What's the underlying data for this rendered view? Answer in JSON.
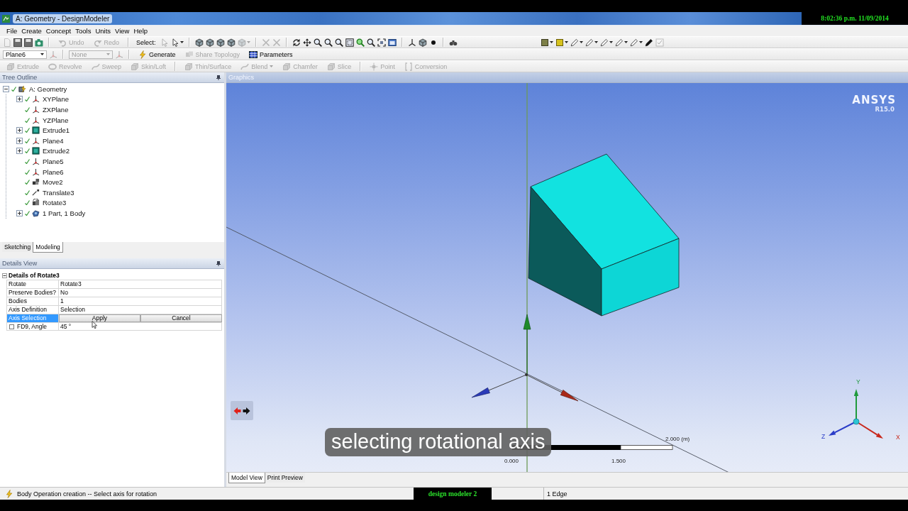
{
  "window": {
    "title": "A: Geometry - DesignModeler",
    "clock": "8:02:36 p.m. 11/09/2014"
  },
  "menu": [
    "File",
    "Create",
    "Concept",
    "Tools",
    "Units",
    "View",
    "Help"
  ],
  "toolbars": [
    [
      [
        {
          "kind": "icon",
          "disabled": true
        },
        {
          "kind": "icon",
          "disabled": false
        },
        {
          "kind": "icon",
          "disabled": false
        },
        {
          "kind": "icon",
          "disabled": false
        },
        {
          "kind": "separator"
        },
        {
          "kind": "button",
          "label": "Undo",
          "disabled": true
        },
        {
          "kind": "button",
          "label": "Redo",
          "disabled": true
        },
        {
          "kind": "separator"
        },
        {
          "kind": "label",
          "label": "Select:",
          "disabled": false
        },
        {
          "kind": "icon",
          "disabled": true
        },
        {
          "kind": "menu_icon",
          "disabled": false
        },
        {
          "kind": "separator"
        },
        {
          "kind": "icon",
          "disabled": false
        },
        {
          "kind": "icon",
          "disabled": false
        },
        {
          "kind": "icon",
          "disabled": false
        },
        {
          "kind": "icon",
          "disabled": false
        },
        {
          "kind": "menu_icon",
          "disabled": true
        },
        {
          "kind": "separator"
        },
        {
          "kind": "icon",
          "disabled": true
        },
        {
          "kind": "icon",
          "disabled": true
        },
        {
          "kind": "separator"
        },
        {
          "kind": "icon",
          "disabled": false
        },
        {
          "kind": "icon",
          "disabled": false
        },
        {
          "kind": "icon",
          "disabled": false
        },
        {
          "kind": "icon",
          "disabled": false
        },
        {
          "kind": "icon",
          "disabled": false
        },
        {
          "kind": "icon",
          "disabled": false
        },
        {
          "kind": "icon",
          "disabled": false
        },
        {
          "kind": "icon",
          "disabled": false
        },
        {
          "kind": "icon",
          "disabled": false
        },
        {
          "kind": "icon",
          "disabled": false
        },
        {
          "kind": "separator"
        },
        {
          "kind": "icon",
          "disabled": false
        },
        {
          "kind": "icon",
          "disabled": false
        },
        {
          "kind": "icon",
          "disabled": false
        },
        {
          "kind": "separator"
        },
        {
          "kind": "icon",
          "disabled": false
        }
      ],
      [
        {
          "kind": "menu_icon",
          "disabled": false
        },
        {
          "kind": "menu_icon",
          "disabled": false
        },
        {
          "kind": "menu_icon",
          "disabled": false
        },
        {
          "kind": "menu_icon",
          "disabled": false
        },
        {
          "kind": "menu_icon",
          "disabled": false
        },
        {
          "kind": "menu_icon",
          "disabled": false
        },
        {
          "kind": "menu_icon",
          "disabled": false
        },
        {
          "kind": "icon",
          "disabled": false
        },
        {
          "kind": "icon",
          "disabled": true
        }
      ]
    ],
    [
      [
        {
          "kind": "dropdown",
          "label": "Plane6",
          "disabled": false
        },
        {
          "kind": "icon",
          "disabled": true
        },
        {
          "kind": "separator"
        },
        {
          "kind": "dropdown",
          "label": "None",
          "disabled": true
        },
        {
          "kind": "icon",
          "disabled": true
        },
        {
          "kind": "separator"
        },
        {
          "kind": "button",
          "label": "Generate",
          "disabled": false
        },
        {
          "kind": "button",
          "label": "Share Topology",
          "disabled": true
        },
        {
          "kind": "button",
          "label": "Parameters",
          "disabled": false
        }
      ]
    ],
    [
      [
        {
          "kind": "button",
          "label": "Extrude",
          "disabled": true
        },
        {
          "kind": "button",
          "label": "Revolve",
          "disabled": true
        },
        {
          "kind": "button",
          "label": "Sweep",
          "disabled": true
        },
        {
          "kind": "button",
          "label": "Skin/Loft",
          "disabled": true
        },
        {
          "kind": "separator"
        },
        {
          "kind": "button",
          "label": "Thin/Surface",
          "disabled": true
        },
        {
          "kind": "menu_button",
          "label": "Blend",
          "disabled": true
        },
        {
          "kind": "button",
          "label": "Chamfer",
          "disabled": true
        },
        {
          "kind": "button",
          "label": "Slice",
          "disabled": true
        },
        {
          "kind": "separator"
        },
        {
          "kind": "button",
          "label": "Point",
          "disabled": true
        },
        {
          "kind": "button",
          "label": "Conversion",
          "disabled": true
        }
      ]
    ]
  ],
  "tree_outline": {
    "title": "Tree Outline",
    "items": [
      {
        "label": "A: Geometry",
        "kind": "geometry",
        "expanded": true,
        "children": [
          {
            "label": "XYPlane",
            "kind": "plane",
            "expanded": false
          },
          {
            "label": "ZXPlane",
            "kind": "plane"
          },
          {
            "label": "YZPlane",
            "kind": "plane"
          },
          {
            "label": "Extrude1",
            "kind": "extrude",
            "expanded": false
          },
          {
            "label": "Plane4",
            "kind": "plane",
            "expanded": false
          },
          {
            "label": "Extrude2",
            "kind": "extrude",
            "expanded": false
          },
          {
            "label": "Plane5",
            "kind": "plane"
          },
          {
            "label": "Plane6",
            "kind": "plane"
          },
          {
            "label": "Move2",
            "kind": "move"
          },
          {
            "label": "Translate3",
            "kind": "translate"
          },
          {
            "label": "Rotate3",
            "kind": "rotate"
          },
          {
            "label": "1 Part, 1 Body",
            "kind": "body",
            "expanded": false
          }
        ]
      }
    ],
    "tabs": [
      {
        "label": "Sketching",
        "selected": false
      },
      {
        "label": "Modeling",
        "selected": true
      }
    ]
  },
  "details_view": {
    "title": "Details View",
    "group": {
      "title": "Details of Rotate3",
      "expanded": true
    },
    "rows": [
      {
        "kind": "text",
        "label": "Rotate",
        "value": "Rotate3",
        "selected": false
      },
      {
        "kind": "text",
        "label": "Preserve Bodies?",
        "value": "No",
        "selected": false
      },
      {
        "kind": "text",
        "label": "Bodies",
        "value": "1",
        "selected": false
      },
      {
        "kind": "text",
        "label": "Axis Definition",
        "value": "Selection",
        "selected": false
      },
      {
        "kind": "buttons",
        "label": "Axis Selection",
        "buttons": [
          "Apply",
          "Cancel"
        ],
        "selected": true
      },
      {
        "kind": "parameter",
        "label": "FD9, Angle",
        "value": "45 °",
        "selected": false,
        "checked": false
      }
    ]
  },
  "graphics": {
    "title": "Graphics",
    "logo": {
      "name": "ANSYS",
      "version": "R15.0"
    },
    "scale_labels": [
      "0.000",
      "1.500",
      "2.000 (m)"
    ],
    "triad": [
      {
        "label": "Y",
        "color": "#1f9a3c"
      },
      {
        "label": "X",
        "color": "#c8281c"
      },
      {
        "label": "Z",
        "color": "#2a3cc8"
      }
    ],
    "caption": "selecting rotational axis",
    "tabs": [
      {
        "label": "Model View",
        "selected": true
      },
      {
        "label": "Print Preview",
        "selected": false
      }
    ]
  },
  "status_bar": {
    "message": "Body Operation creation -- Select axis for rotation",
    "overlay_label": "design modeler 2",
    "selection": "1 Edge"
  }
}
